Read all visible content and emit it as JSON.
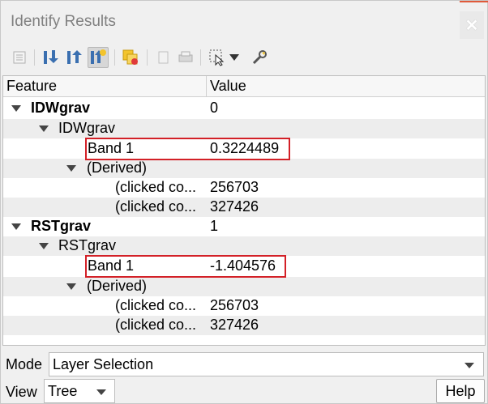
{
  "window": {
    "title": "Identify Results"
  },
  "toolbar": {
    "buttons": [
      "expand-new-results-icon",
      "expand-all-icon",
      "collapse-all-icon",
      "highlight-icon",
      "clear-highlights-icon",
      "copy-feature-icon",
      "print-icon",
      "identify-select-icon",
      "dropdown-icon",
      "settings-wrench-icon"
    ]
  },
  "tree": {
    "headers": {
      "feature": "Feature",
      "value": "Value"
    },
    "rows": [
      {
        "label": "IDWgrav",
        "value": "0"
      },
      {
        "label": "IDWgrav",
        "value": ""
      },
      {
        "label": "Band 1",
        "value": "0.3224489"
      },
      {
        "label": "(Derived)",
        "value": ""
      },
      {
        "label": "(clicked co...",
        "value": "256703"
      },
      {
        "label": "(clicked co...",
        "value": "327426"
      },
      {
        "label": "RSTgrav",
        "value": "1"
      },
      {
        "label": "RSTgrav",
        "value": ""
      },
      {
        "label": "Band 1",
        "value": "-1.404576"
      },
      {
        "label": "(Derived)",
        "value": ""
      },
      {
        "label": "(clicked co...",
        "value": "256703"
      },
      {
        "label": "(clicked co...",
        "value": "327426"
      }
    ]
  },
  "bottom": {
    "mode_label": "Mode",
    "mode_value": "Layer Selection",
    "view_label": "View",
    "view_value": "Tree",
    "help_label": "Help"
  },
  "colors": {
    "highlight_border": "#d32027"
  }
}
